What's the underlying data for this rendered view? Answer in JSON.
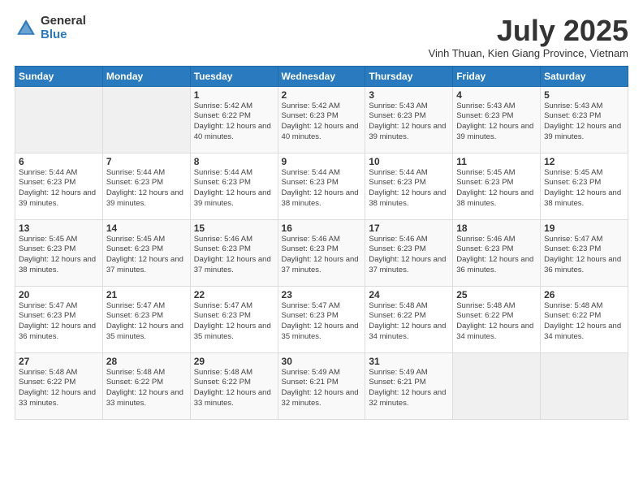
{
  "logo": {
    "general": "General",
    "blue": "Blue"
  },
  "title": "July 2025",
  "subtitle": "Vinh Thuan, Kien Giang Province, Vietnam",
  "days_of_week": [
    "Sunday",
    "Monday",
    "Tuesday",
    "Wednesday",
    "Thursday",
    "Friday",
    "Saturday"
  ],
  "weeks": [
    [
      {
        "day": "",
        "info": ""
      },
      {
        "day": "",
        "info": ""
      },
      {
        "day": "1",
        "info": "Sunrise: 5:42 AM\nSunset: 6:22 PM\nDaylight: 12 hours and 40 minutes."
      },
      {
        "day": "2",
        "info": "Sunrise: 5:42 AM\nSunset: 6:23 PM\nDaylight: 12 hours and 40 minutes."
      },
      {
        "day": "3",
        "info": "Sunrise: 5:43 AM\nSunset: 6:23 PM\nDaylight: 12 hours and 39 minutes."
      },
      {
        "day": "4",
        "info": "Sunrise: 5:43 AM\nSunset: 6:23 PM\nDaylight: 12 hours and 39 minutes."
      },
      {
        "day": "5",
        "info": "Sunrise: 5:43 AM\nSunset: 6:23 PM\nDaylight: 12 hours and 39 minutes."
      }
    ],
    [
      {
        "day": "6",
        "info": "Sunrise: 5:44 AM\nSunset: 6:23 PM\nDaylight: 12 hours and 39 minutes."
      },
      {
        "day": "7",
        "info": "Sunrise: 5:44 AM\nSunset: 6:23 PM\nDaylight: 12 hours and 39 minutes."
      },
      {
        "day": "8",
        "info": "Sunrise: 5:44 AM\nSunset: 6:23 PM\nDaylight: 12 hours and 39 minutes."
      },
      {
        "day": "9",
        "info": "Sunrise: 5:44 AM\nSunset: 6:23 PM\nDaylight: 12 hours and 38 minutes."
      },
      {
        "day": "10",
        "info": "Sunrise: 5:44 AM\nSunset: 6:23 PM\nDaylight: 12 hours and 38 minutes."
      },
      {
        "day": "11",
        "info": "Sunrise: 5:45 AM\nSunset: 6:23 PM\nDaylight: 12 hours and 38 minutes."
      },
      {
        "day": "12",
        "info": "Sunrise: 5:45 AM\nSunset: 6:23 PM\nDaylight: 12 hours and 38 minutes."
      }
    ],
    [
      {
        "day": "13",
        "info": "Sunrise: 5:45 AM\nSunset: 6:23 PM\nDaylight: 12 hours and 38 minutes."
      },
      {
        "day": "14",
        "info": "Sunrise: 5:45 AM\nSunset: 6:23 PM\nDaylight: 12 hours and 37 minutes."
      },
      {
        "day": "15",
        "info": "Sunrise: 5:46 AM\nSunset: 6:23 PM\nDaylight: 12 hours and 37 minutes."
      },
      {
        "day": "16",
        "info": "Sunrise: 5:46 AM\nSunset: 6:23 PM\nDaylight: 12 hours and 37 minutes."
      },
      {
        "day": "17",
        "info": "Sunrise: 5:46 AM\nSunset: 6:23 PM\nDaylight: 12 hours and 37 minutes."
      },
      {
        "day": "18",
        "info": "Sunrise: 5:46 AM\nSunset: 6:23 PM\nDaylight: 12 hours and 36 minutes."
      },
      {
        "day": "19",
        "info": "Sunrise: 5:47 AM\nSunset: 6:23 PM\nDaylight: 12 hours and 36 minutes."
      }
    ],
    [
      {
        "day": "20",
        "info": "Sunrise: 5:47 AM\nSunset: 6:23 PM\nDaylight: 12 hours and 36 minutes."
      },
      {
        "day": "21",
        "info": "Sunrise: 5:47 AM\nSunset: 6:23 PM\nDaylight: 12 hours and 35 minutes."
      },
      {
        "day": "22",
        "info": "Sunrise: 5:47 AM\nSunset: 6:23 PM\nDaylight: 12 hours and 35 minutes."
      },
      {
        "day": "23",
        "info": "Sunrise: 5:47 AM\nSunset: 6:23 PM\nDaylight: 12 hours and 35 minutes."
      },
      {
        "day": "24",
        "info": "Sunrise: 5:48 AM\nSunset: 6:22 PM\nDaylight: 12 hours and 34 minutes."
      },
      {
        "day": "25",
        "info": "Sunrise: 5:48 AM\nSunset: 6:22 PM\nDaylight: 12 hours and 34 minutes."
      },
      {
        "day": "26",
        "info": "Sunrise: 5:48 AM\nSunset: 6:22 PM\nDaylight: 12 hours and 34 minutes."
      }
    ],
    [
      {
        "day": "27",
        "info": "Sunrise: 5:48 AM\nSunset: 6:22 PM\nDaylight: 12 hours and 33 minutes."
      },
      {
        "day": "28",
        "info": "Sunrise: 5:48 AM\nSunset: 6:22 PM\nDaylight: 12 hours and 33 minutes."
      },
      {
        "day": "29",
        "info": "Sunrise: 5:48 AM\nSunset: 6:22 PM\nDaylight: 12 hours and 33 minutes."
      },
      {
        "day": "30",
        "info": "Sunrise: 5:49 AM\nSunset: 6:21 PM\nDaylight: 12 hours and 32 minutes."
      },
      {
        "day": "31",
        "info": "Sunrise: 5:49 AM\nSunset: 6:21 PM\nDaylight: 12 hours and 32 minutes."
      },
      {
        "day": "",
        "info": ""
      },
      {
        "day": "",
        "info": ""
      }
    ]
  ]
}
